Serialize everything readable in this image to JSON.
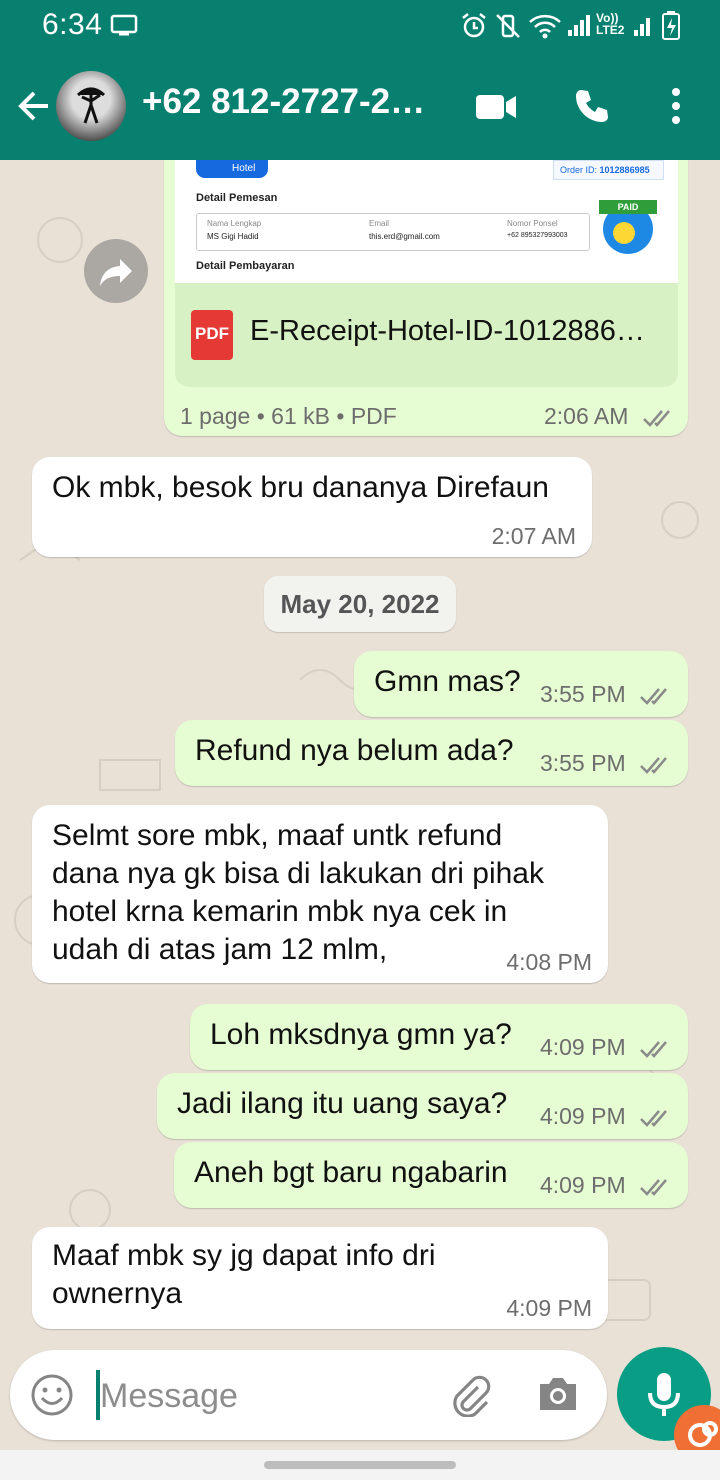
{
  "status_bar": {
    "time": "6:34",
    "network_label": "Vo)) LTE2"
  },
  "header": {
    "contact_name": "+62 812-2727-26…"
  },
  "receipt_preview": {
    "tag": "Hotel",
    "order_label": "Order ID:",
    "order_id": "1012886985",
    "section_booking": "Detail Pemesan",
    "name_label": "Nama Lengkap",
    "name_value": "MS Gigi Hadid",
    "email_label": "Email",
    "email_value": "this.erd@gmail.com",
    "phone_label": "Nomor Ponsel",
    "phone_value": "+62 895327993003",
    "paid_badge": "PAID",
    "section_payment": "Detail Pembayaran"
  },
  "document_message": {
    "file_name": "E-Receipt-Hotel-ID-1012886…",
    "pdf_label": "PDF",
    "info": "1 page • 61 kB • PDF",
    "time": "2:06 AM"
  },
  "messages": [
    {
      "direction": "in",
      "text": "Ok mbk, besok bru dananya Direfaun",
      "time": "2:07 AM"
    },
    {
      "direction": "out",
      "text": "Gmn mas?",
      "time": "3:55 PM"
    },
    {
      "direction": "out",
      "text": "Refund nya belum ada?",
      "time": "3:55 PM"
    },
    {
      "direction": "in",
      "text": "Selmt sore mbk, maaf untk refund\ndana nya gk bisa di lakukan dri pihak\nhotel krna kemarin mbk nya cek in\nudah di atas jam 12 mlm,",
      "time": "4:08 PM"
    },
    {
      "direction": "out",
      "text": "Loh mksdnya gmn ya?",
      "time": "4:09 PM"
    },
    {
      "direction": "out",
      "text": "Jadi ilang itu uang saya?",
      "time": "4:09 PM"
    },
    {
      "direction": "out",
      "text": "Aneh bgt baru ngabarin",
      "time": "4:09 PM"
    },
    {
      "direction": "in",
      "text": "Maaf mbk sy jg dapat info dri\nownernya",
      "time": "4:09 PM"
    }
  ],
  "date_divider": "May 20, 2022",
  "composer": {
    "placeholder": "Message"
  },
  "colors": {
    "header": "#08806f",
    "outgoing": "#e6fdd3",
    "incoming": "#ffffff",
    "accent": "#0a9d85",
    "read_ticks": "#8a8a8a"
  },
  "icons": [
    "back-arrow-icon",
    "video-call-icon",
    "phone-icon",
    "more-vert-icon",
    "forward-icon",
    "pdf-icon",
    "emoji-icon",
    "attach-icon",
    "camera-icon",
    "mic-icon",
    "double-check-icon"
  ]
}
